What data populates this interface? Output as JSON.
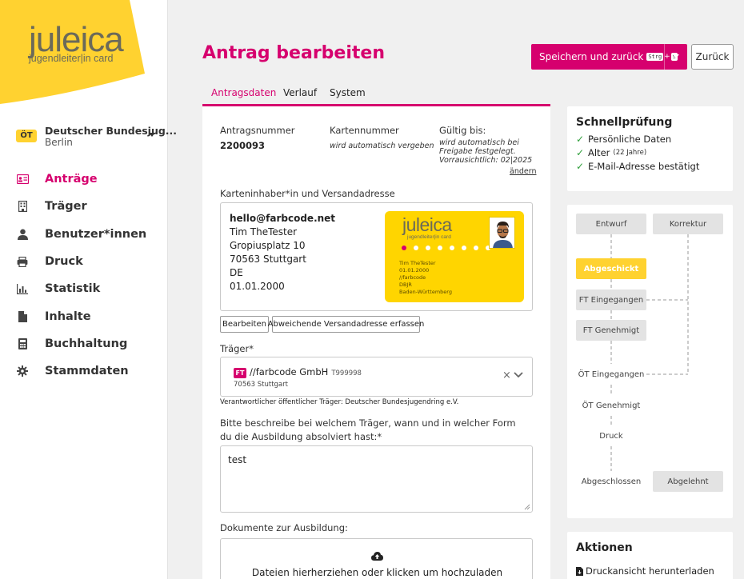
{
  "brand": {
    "logo_text": "juleica",
    "logo_sub": "jugendleiter|in card",
    "accent": "#d6006e",
    "yellow": "#ffd230"
  },
  "org": {
    "badge": "ÖT",
    "name": "Deutscher Bundesjug...",
    "city": "Berlin"
  },
  "nav": [
    {
      "label": "Anträge",
      "icon": "id-card-icon",
      "active": true
    },
    {
      "label": "Träger",
      "icon": "building-icon",
      "active": false
    },
    {
      "label": "Benutzer*innen",
      "icon": "user-icon",
      "active": false
    },
    {
      "label": "Druck",
      "icon": "printer-icon",
      "active": false
    },
    {
      "label": "Statistik",
      "icon": "bar-chart-icon",
      "active": false
    },
    {
      "label": "Inhalte",
      "icon": "document-icon",
      "active": false
    },
    {
      "label": "Buchhaltung",
      "icon": "calculator-icon",
      "active": false
    },
    {
      "label": "Stammdaten",
      "icon": "gear-icon",
      "active": false
    }
  ],
  "header": {
    "title": "Antrag bearbeiten",
    "save_label": "Speichern und zurück",
    "kbd_ctrl": "Strg",
    "kbd_plus": "+",
    "kbd_key": "S",
    "back_label": "Zurück"
  },
  "tabs": [
    {
      "label": "Antragsdaten",
      "active": true
    },
    {
      "label": "Verlauf",
      "active": false
    },
    {
      "label": "System",
      "active": false
    }
  ],
  "form": {
    "antragsnummer_label": "Antragsnummer",
    "antragsnummer": "2200093",
    "kartennummer_label": "Kartennummer",
    "kartennummer": "wird automatisch vergeben",
    "gueltig_label": "Gültig bis:",
    "gueltig_1": "wird automatisch bei",
    "gueltig_2": "Freigabe festgelegt.",
    "gueltig_3": "Vorrausichtlich: 02|2025",
    "aendern": "ändern",
    "holder_label": "Karteninhaber*in und Versandadresse",
    "address": [
      "hello@farbcode.net",
      "Tim TheTester",
      "Gropiusplatz 10",
      "70563 Stuttgart",
      "DE",
      "01.01.2000"
    ],
    "card": {
      "logo": "juleica",
      "sub": "jugendleiter|in card",
      "lines": [
        "Tim TheTester",
        "01.01.2000",
        "//farbcode",
        "DBJR",
        "Baden-Württemberg"
      ]
    },
    "btn_edit": "Bearbeiten",
    "btn_other_address": "Abweichende Versandadresse erfassen",
    "traeger_label": "Träger*",
    "traeger_badge": "FT",
    "traeger_name": "//farbcode GmbH",
    "traeger_code": "T999998",
    "traeger_city": "70563 Stuttgart",
    "traeger_note": "Verantwortlicher öffentlicher Träger: Deutscher Bundesjugendring e.V.",
    "question": "Bitte beschreibe bei welchem Träger, wann und in welcher Form du die Ausbildung absolviert hast:*",
    "answer": "test",
    "docs_label": "Dokumente zur Ausbildung:",
    "upload_text": "Dateien hierherziehen oder klicken um hochzuladen"
  },
  "quick": {
    "title": "Schnellprüfung",
    "checks": [
      {
        "label": "Persönliche Daten",
        "note": ""
      },
      {
        "label": "Alter",
        "note": "(22 Jahre)"
      },
      {
        "label": "E-Mail-Adresse bestätigt",
        "note": ""
      }
    ]
  },
  "workflow": {
    "entwurf": "Entwurf",
    "korrektur": "Korrektur",
    "abgeschickt": "Abgeschickt",
    "ft_eingegangen": "FT Eingegangen",
    "ft_genehmigt": "FT Genehmigt",
    "oet_eingegangen": "ÖT Eingegangen",
    "oet_genehmigt": "ÖT Genehmigt",
    "druck": "Druck",
    "abgeschlossen": "Abgeschlossen",
    "abgelehnt": "Abgelehnt"
  },
  "actions": {
    "title": "Aktionen",
    "download": "Druckansicht herunterladen"
  }
}
